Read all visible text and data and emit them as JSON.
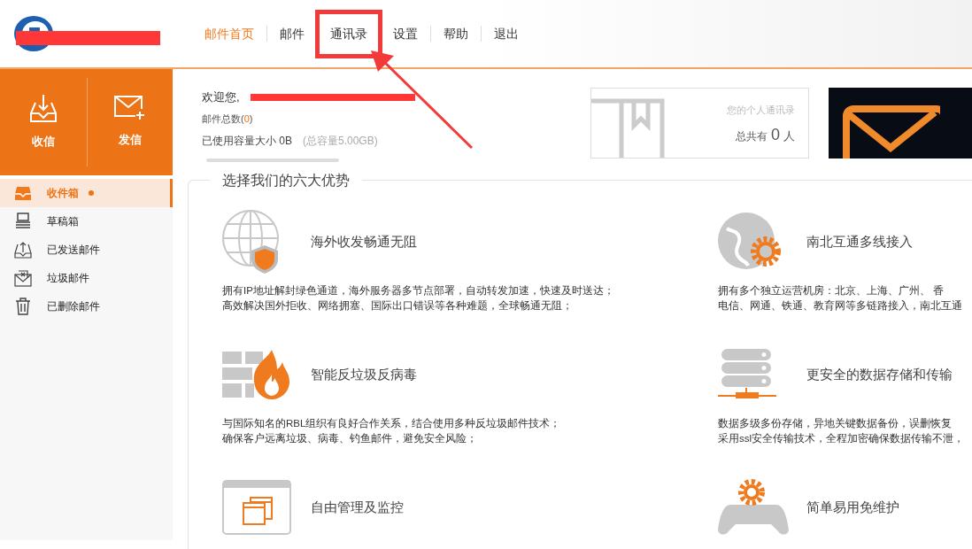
{
  "header": {
    "nav": [
      {
        "label": "邮件首页",
        "selected": true,
        "annotated": false
      },
      {
        "label": "邮件",
        "selected": false,
        "annotated": false
      },
      {
        "label": "通讯录",
        "selected": false,
        "annotated": true
      },
      {
        "label": "设置",
        "selected": false,
        "annotated": false
      },
      {
        "label": "帮助",
        "selected": false,
        "annotated": false
      },
      {
        "label": "退出",
        "selected": false,
        "annotated": false
      }
    ]
  },
  "quick_actions": [
    {
      "kind": "receive",
      "label": "收信"
    },
    {
      "kind": "send",
      "label": "发信"
    }
  ],
  "welcome": {
    "greeting": "欢迎您,",
    "mail_count_label": "邮件总数(",
    "mail_count": "0",
    "mail_count_close": ")",
    "usage_label": "已使用容量大小 0B",
    "total": "(总容量5.00GB)",
    "usage": {
      "level": 0
    }
  },
  "contacts_card": {
    "title": "您的个人通讯录",
    "count_prefix": "总共有",
    "count": "0",
    "count_suffix": "人"
  },
  "sidebar": {
    "items": [
      {
        "kind": "inbox",
        "label": "收件箱",
        "selected": true,
        "unread": true
      },
      {
        "kind": "drafts",
        "label": "草稿箱",
        "selected": false,
        "unread": false
      },
      {
        "kind": "sent",
        "label": "已发送邮件",
        "selected": false,
        "unread": false
      },
      {
        "kind": "spam",
        "label": "垃圾邮件",
        "selected": false,
        "unread": false
      },
      {
        "kind": "trash",
        "label": "已删除邮件",
        "selected": false,
        "unread": false
      }
    ]
  },
  "features": {
    "title": "选择我们的六大优势",
    "items": [
      {
        "kind": "globe-shield",
        "title": "海外收发畅通无阻",
        "lines": [
          "拥有IP地址解封绿色通道，海外服务器多节点部署，自动转发加速，快速及时送达；",
          "高效解决国外拒收、网络拥塞、国际出口错误等各种难题，全球畅通无阻；"
        ]
      },
      {
        "kind": "globe-gear",
        "title": "南北互通多线接入",
        "lines": [
          "拥有多个独立运营机房：北京、上海、广州、 香",
          "电信、网通、铁通、教育网等多链路接入，南北互通"
        ]
      },
      {
        "kind": "firewall",
        "title": "智能反垃圾反病毒",
        "lines": [
          "与国际知名的RBL组织有良好合作关系，结合使用多种反垃圾邮件技术；",
          "确保客户远离垃圾、病毒、钓鱼邮件，避免安全风险；"
        ]
      },
      {
        "kind": "server",
        "title": "更安全的数据存储和传输",
        "lines": [
          "数据多级多份存储，异地关键数据备份，误删恢复",
          "采用ssl安全传输技术，全程加密确保数据传输不泄，"
        ]
      },
      {
        "kind": "windows",
        "title": "自由管理及监控"
      },
      {
        "kind": "gamepad",
        "title": "简单易用免维护"
      }
    ]
  }
}
